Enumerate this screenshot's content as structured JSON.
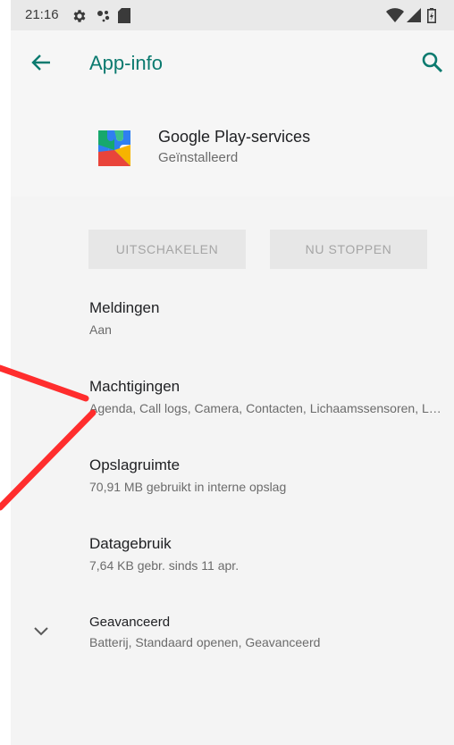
{
  "status_bar": {
    "time": "21:16",
    "icons": [
      "settings-icon",
      "assistant-dots-icon",
      "sd-card-icon",
      "wifi-icon",
      "signal-icon",
      "battery-icon"
    ]
  },
  "app_bar": {
    "title": "App-info",
    "back_icon": "arrow-back-icon",
    "search_icon": "search-icon"
  },
  "app": {
    "name": "Google Play-services",
    "status": "Geïnstalleerd",
    "icon": "google-play-services-icon"
  },
  "buttons": {
    "disable": "UITSCHAKELEN",
    "force_stop": "NU STOPPEN"
  },
  "items": [
    {
      "title": "Meldingen",
      "subtitle": "Aan"
    },
    {
      "title": "Machtigingen",
      "subtitle": "Agenda, Call logs, Camera, Contacten, Lichaamssensoren, Locatie, Microfoon, SMS, Telefoon"
    },
    {
      "title": "Opslagruimte",
      "subtitle": "70,91 MB gebruikt in interne opslag"
    },
    {
      "title": "Datagebruik",
      "subtitle": "7,64  KB gebr. sinds 11 apr."
    },
    {
      "title": "Geavanceerd",
      "subtitle": "Batterij, Standaard openen, Geavanceerd"
    }
  ],
  "colors": {
    "accent": "#0b7a6f",
    "annotation_line": "#ff2d2d"
  }
}
